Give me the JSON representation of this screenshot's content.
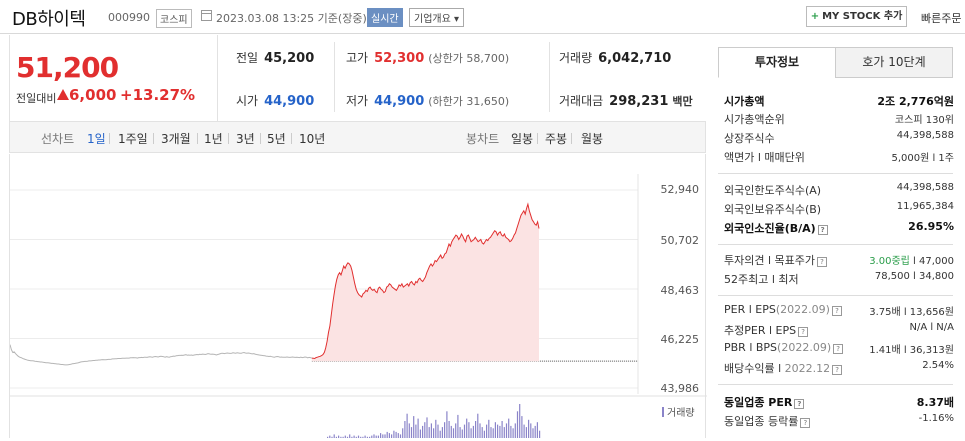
{
  "header": {
    "name": "DB하이텍",
    "code": "000990",
    "market": "코스피",
    "datetime": "2023.03.08 13:25 기준(장중)",
    "live": "실시간",
    "company_info": "기업개요 ▾",
    "mystock_plus": "+",
    "mystock": "MY STOCK 추가",
    "quick_order": "빠른주문"
  },
  "price": {
    "current": "51,200",
    "change_label": "전일대비",
    "change": "6,000",
    "change_pct": "+13.27%"
  },
  "stats": {
    "prev_label": "전일",
    "prev": "45,200",
    "high_label": "고가",
    "high": "52,300",
    "upper_limit": "(상한가 58,700)",
    "volume_label": "거래량",
    "volume": "6,042,710",
    "open_label": "시가",
    "open": "44,900",
    "low_label": "저가",
    "low": "44,900",
    "lower_limit": "(하한가 31,650)",
    "amount_label": "거래대금",
    "amount": "298,231",
    "amount_unit": "백만"
  },
  "tabs": {
    "line_label": "선차트",
    "line": [
      "1일",
      "1주일",
      "3개월",
      "1년",
      "3년",
      "5년",
      "10년"
    ],
    "candle_label": "봉차트",
    "candle": [
      "일봉",
      "주봉",
      "월봉"
    ],
    "active": "1일"
  },
  "colors": {
    "up": "#e12f2f",
    "down": "#2563c9",
    "area": "#fbe3e3",
    "volume": "#8a84c9"
  },
  "chart_data": {
    "type": "line",
    "title": "",
    "y_ticks": [
      "52,940",
      "50,702",
      "48,463",
      "46,225",
      "43,986"
    ],
    "ylim": [
      43986,
      52940
    ],
    "baseline": 45200,
    "volume_label": "거래량",
    "series": [
      {
        "values": [
          45950,
          45720,
          45590,
          45620,
          45540,
          45480,
          45420,
          45380,
          45360,
          45330,
          45300,
          45280,
          45260,
          45240,
          45230,
          45220,
          45220,
          45210,
          45200,
          45190,
          45180,
          45170,
          45160,
          45160,
          45150,
          45140,
          45130,
          45130,
          45120,
          45110,
          45100,
          45100,
          45090,
          45080,
          45070,
          45070,
          45060,
          45050,
          45050,
          45040,
          45030,
          45030,
          45040,
          45050,
          45060,
          45080,
          45090,
          45100,
          45110,
          45120,
          45140,
          45160,
          45170,
          45180,
          45190,
          45190,
          45200,
          45210,
          45210,
          45220,
          45230,
          45230,
          45240,
          45240,
          45250,
          45250,
          45260,
          45270,
          45260,
          45260,
          45270,
          45280,
          45280,
          45290,
          45300,
          45300,
          45310,
          45310,
          45320,
          45320,
          45320,
          45330,
          45330,
          45330,
          45340,
          45340,
          45340,
          45350,
          45350,
          45360,
          45350,
          45350,
          45340,
          45360,
          45360,
          45370,
          45360,
          45380,
          45380,
          45370,
          45390,
          45400,
          45390,
          45380,
          45400,
          45410,
          45400,
          45390,
          45410,
          45420,
          45410,
          45400,
          45380,
          45400,
          45390,
          45380,
          45400,
          45410,
          45430,
          45420,
          45440,
          45450,
          45460,
          45460,
          45470,
          45460,
          45480,
          45490,
          45470,
          45480,
          45470,
          45480,
          45460,
          45480,
          45490,
          45500,
          45490,
          45510,
          45500,
          45520,
          45510,
          45500,
          45520,
          45540,
          45530,
          45510,
          45520,
          45510,
          45500,
          45480,
          45500,
          45520,
          45540,
          45560,
          45550,
          45540,
          45560,
          45570,
          45560,
          45550,
          45560,
          45580,
          45570,
          45560,
          45580,
          45570,
          45560,
          45560,
          45580,
          45590,
          45570,
          45560,
          45570,
          45560,
          45540,
          45530,
          45540,
          45520,
          45500,
          45490,
          45480,
          45470,
          45460,
          45450,
          45440,
          45430,
          45420,
          45410,
          45420,
          45400,
          45390,
          45380,
          45400,
          45410,
          45400,
          45380,
          45390,
          45380,
          45380,
          45380,
          45390,
          45380,
          45370,
          45380,
          45390,
          45380,
          45370,
          45380,
          45370,
          45360,
          45380,
          45360,
          45370,
          45390,
          45380,
          45350,
          45370,
          45360,
          45340,
          45330,
          45320,
          45360,
          45380,
          45400,
          45420,
          45450,
          45500,
          45600,
          45800,
          46100,
          46500,
          46800,
          47300,
          47800,
          48200,
          48600,
          48900,
          49100,
          49200,
          49100,
          49300,
          49500,
          49400,
          49550,
          49650,
          49600,
          49500,
          49300,
          49000,
          48700,
          48450,
          48300,
          48200,
          48150,
          48100,
          48250,
          48300,
          48400,
          48350,
          48500,
          48550,
          48450,
          48400,
          48450,
          48350,
          48300,
          48500,
          48550,
          48450,
          48400,
          48300,
          48350,
          48550,
          48600,
          48700,
          48650,
          48550,
          48500,
          48450,
          48400,
          48500,
          48650,
          48600,
          48700,
          48550,
          48600,
          48650,
          48700,
          48600,
          48750,
          48800,
          48700,
          48650,
          48800,
          48750,
          48900,
          48950,
          48850,
          48800,
          48900,
          49000,
          49200,
          49350,
          49500,
          49600,
          49500,
          49600,
          49750,
          49700,
          49800,
          49900,
          50000,
          49850,
          49900,
          50050,
          50100,
          50300,
          50500,
          50400,
          50600,
          50700,
          50800,
          50900,
          50850,
          50700,
          50800,
          50950,
          50850,
          50700,
          50600,
          50850,
          50900,
          50750,
          50600,
          50650,
          50700,
          50800,
          50700,
          50600,
          50650,
          50700,
          50550,
          50500,
          50600,
          50700,
          50650,
          50750,
          50800,
          50900,
          51000,
          51100,
          51050,
          50900,
          51000,
          51050,
          50900,
          50850,
          50950,
          50800,
          50750,
          50700,
          50600,
          50650,
          50750,
          50900,
          51000,
          51200,
          51400,
          51600,
          51800,
          51900,
          52000,
          51850,
          52100,
          52300,
          52000,
          51800,
          51600,
          51500,
          51400,
          51350,
          51500,
          51200
        ]
      }
    ],
    "volume": [
      1,
      2,
      1,
      3,
      1,
      2,
      1,
      1,
      2,
      1,
      3,
      1,
      2,
      1,
      2,
      1,
      1,
      2,
      1,
      1,
      2,
      3,
      2,
      2,
      4,
      3,
      3,
      5,
      4,
      3,
      6,
      5,
      4,
      3,
      8,
      14,
      20,
      12,
      9,
      18,
      11,
      16,
      7,
      10,
      13,
      17,
      9,
      12,
      8,
      15,
      11,
      6,
      9,
      13,
      22,
      14,
      10,
      8,
      12,
      19,
      9,
      7,
      11,
      16,
      13,
      8,
      10,
      14,
      20,
      12,
      9,
      6,
      11,
      15,
      9,
      8,
      13,
      11,
      10,
      14,
      9,
      12,
      16,
      10,
      8,
      12,
      22,
      28,
      18,
      11,
      9,
      15,
      12,
      8,
      10,
      13,
      6
    ]
  },
  "side": {
    "tab_active": "투자정보",
    "tab_other": "호가 10단계",
    "rows1": [
      {
        "k": "시가총액",
        "v": "2조 2,776억원",
        "kb": true,
        "vb": true
      },
      {
        "k": "시가총액순위",
        "v": "코스피 130위"
      },
      {
        "k": "상장주식수",
        "v": "44,398,588"
      },
      {
        "k": "액면가 l 매매단위",
        "v": "5,000원 l 1주"
      }
    ],
    "rows2": [
      {
        "k": "외국인한도주식수(A)",
        "v": "44,398,588"
      },
      {
        "k": "외국인보유주식수(B)",
        "v": "11,965,384"
      },
      {
        "k": "외국인소진율(B/A)",
        "v": "26.95%",
        "kb": true,
        "vb": true,
        "q": "?"
      }
    ],
    "rows3": [
      {
        "k": "투자의견 l 목표주가",
        "v1": "3.00중립",
        "v2": " l 47,000",
        "q": "?"
      },
      {
        "k": "52주최고 l 최저",
        "v": "78,500 l 34,800"
      }
    ],
    "rows4": [
      {
        "k": "PER l EPS",
        "k2": "(2022.09)",
        "v": "3.75배 l 13,656원",
        "q": "?"
      },
      {
        "k": "추정PER l EPS",
        "v": "N/A l N/A",
        "q": "?"
      },
      {
        "k": "PBR l BPS",
        "k2": "(2022.09)",
        "v": "1.41배 l 36,313원",
        "q": "?"
      },
      {
        "k": "배당수익률 l ",
        "k2": "2022.12",
        "v": "2.54%",
        "q": "?"
      }
    ],
    "rows5": [
      {
        "k": "동일업종 PER",
        "v": "8.37배",
        "vb": true,
        "q": "?"
      },
      {
        "k": "동일업종 등락률",
        "v": "-1.16%",
        "q": "?"
      }
    ]
  }
}
